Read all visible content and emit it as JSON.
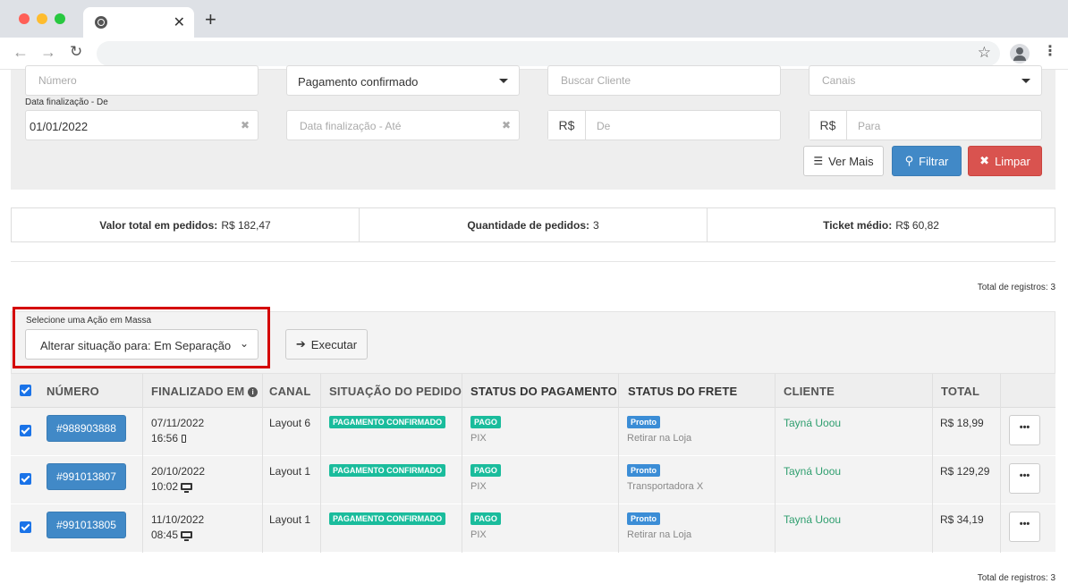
{
  "browser": {
    "tab_close": "✕",
    "new_tab": "+"
  },
  "filters": {
    "numero_placeholder": "Número",
    "pagamento_value": "Pagamento confirmado",
    "cliente_placeholder": "Buscar Cliente",
    "canais_placeholder": "Canais",
    "data_de_label": "Data finalização - De",
    "data_de_value": "01/01/2022",
    "data_ate_placeholder": "Data finalização - Até",
    "currency_label": "R$",
    "valor_de_placeholder": "De",
    "valor_para_placeholder": "Para",
    "ver_mais_label": "Ver Mais",
    "filtrar_label": "Filtrar",
    "limpar_label": "Limpar"
  },
  "stats": {
    "valor_total_label": "Valor total em pedidos:",
    "valor_total_value": "R$ 182,47",
    "quantidade_label": "Quantidade de pedidos:",
    "quantidade_value": "3",
    "ticket_label": "Ticket médio:",
    "ticket_value": "R$ 60,82"
  },
  "total_registros": "Total de registros: 3",
  "mass_action": {
    "label": "Selecione uma Ação em Massa",
    "selected": "Alterar situação para: Em Separação",
    "execute_label": "Executar"
  },
  "table": {
    "headers": {
      "numero": "NÚMERO",
      "finalizado": "FINALIZADO EM",
      "canal": "CANAL",
      "situacao": "SITUAÇÃO DO PEDIDO",
      "status_pagamento": "STATUS DO PAGAMENTO",
      "status_frete": "STATUS DO FRETE",
      "cliente": "CLIENTE",
      "total": "TOTAL"
    },
    "rows": [
      {
        "numero": "#988903888",
        "data": "07/11/2022",
        "hora": "16:56",
        "device": "phone",
        "canal": "Layout 6",
        "situacao": "PAGAMENTO CONFIRMADO",
        "pagamento": "PAGO",
        "metodo": "PIX",
        "frete": "Pronto",
        "frete_tipo": "Retirar na Loja",
        "cliente": "Tayná Uoou",
        "total": "R$ 18,99",
        "acao": "•••"
      },
      {
        "numero": "#991013807",
        "data": "20/10/2022",
        "hora": "10:02",
        "device": "desktop",
        "canal": "Layout 1",
        "situacao": "PAGAMENTO CONFIRMADO",
        "pagamento": "PAGO",
        "metodo": "PIX",
        "frete": "Pronto",
        "frete_tipo": "Transportadora X",
        "cliente": "Tayná Uoou",
        "total": "R$ 129,29",
        "acao": "•••"
      },
      {
        "numero": "#991013805",
        "data": "11/10/2022",
        "hora": "08:45",
        "device": "desktop",
        "canal": "Layout 1",
        "situacao": "PAGAMENTO CONFIRMADO",
        "pagamento": "PAGO",
        "metodo": "PIX",
        "frete": "Pronto",
        "frete_tipo": "Retirar na Loja",
        "cliente": "Tayná Uoou",
        "total": "R$ 34,19",
        "acao": "•••"
      }
    ]
  }
}
